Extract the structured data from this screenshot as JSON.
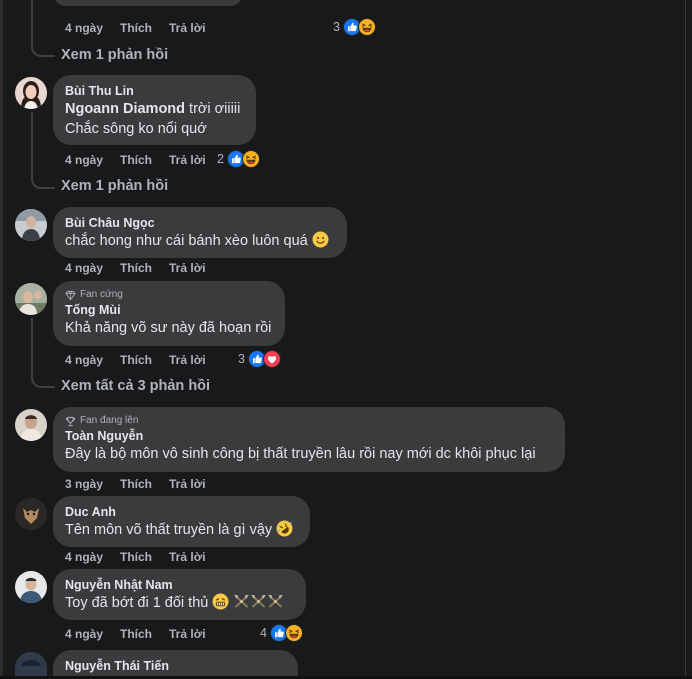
{
  "comments": [
    {
      "time": "4 ngày",
      "like": "Thích",
      "reply": "Trả lời",
      "react_count": "3",
      "react_icons": [
        "like-icon",
        "haha-icon"
      ],
      "view_replies": "Xem 1 phản hồi"
    },
    {
      "author": "Bùi Thu Lin",
      "mention": "Ngoann Diamond",
      "text_line1": " trời ơiiiii",
      "text_line2": "Chắc sông ko nổi quớ",
      "time": "4 ngày",
      "like": "Thích",
      "reply": "Trả lời",
      "react_count": "2",
      "react_icons": [
        "like-icon",
        "haha-icon"
      ],
      "view_replies": "Xem 1 phản hồi"
    },
    {
      "author": "Bùi Châu Ngọc",
      "text": "chắc hong như cái bánh xèo luôn quá",
      "time": "4 ngày",
      "like": "Thích",
      "reply": "Trả lời"
    },
    {
      "badge": "Fan cứng",
      "author": "Tống Mùi",
      "text": "Khả năng võ sư này đã hoạn rồi",
      "time": "4 ngày",
      "like": "Thích",
      "reply": "Trả lời",
      "react_count": "3",
      "react_icons": [
        "like-icon",
        "love-icon"
      ],
      "view_replies": "Xem tất cả 3 phản hồi"
    },
    {
      "badge": "Fan đang lên",
      "author": "Toàn Nguyễn",
      "text": "Đây là bộ môn vô sinh công bị thất truyền lâu rồi nay mới dc khôi phục lại",
      "time": "3 ngày",
      "like": "Thích",
      "reply": "Trả lời"
    },
    {
      "author": "Duc Anh",
      "text": "Tên môn võ thất truyền là gì vậy",
      "time": "4 ngày",
      "like": "Thích",
      "reply": "Trả lời"
    },
    {
      "author": "Nguyễn Nhật Nam",
      "text": "Toy đã bớt đi 1 đối thủ",
      "time": "4 ngày",
      "like": "Thích",
      "reply": "Trả lời",
      "react_count": "4",
      "react_icons": [
        "like-icon",
        "haha-icon"
      ]
    },
    {
      "author": "Nguyễn Thái Tiến"
    }
  ],
  "colors": {
    "background": "#18191a",
    "bubble": "#3a3b3c",
    "primary_text": "#e4e6eb",
    "secondary_text": "#b0b3b8",
    "like_blue": "#1877f2",
    "love_red": "#f33e58",
    "haha_yellow": "#f7b125"
  }
}
